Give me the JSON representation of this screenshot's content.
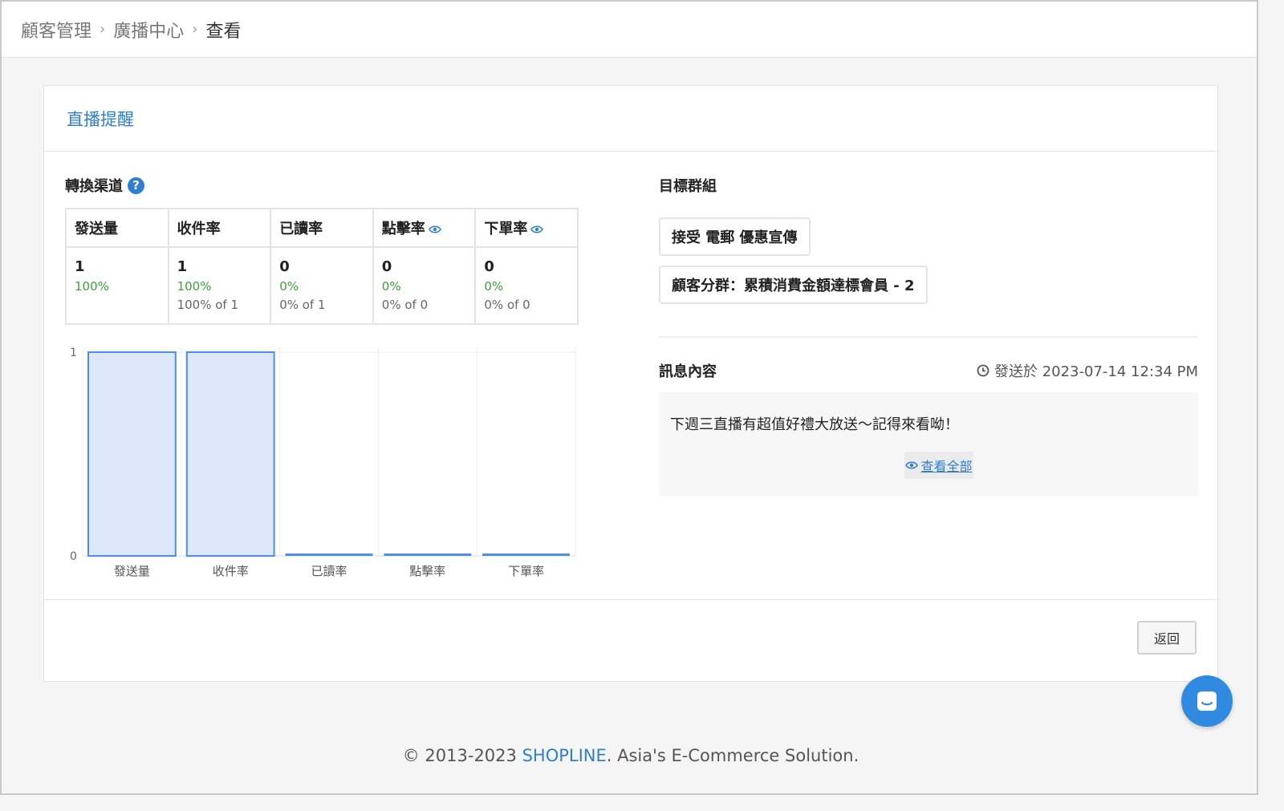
{
  "breadcrumb": {
    "items": [
      "顧客管理",
      "廣播中心"
    ],
    "current": "查看",
    "separator": "›"
  },
  "card": {
    "title": "直播提醒"
  },
  "conversion": {
    "title": "轉換渠道",
    "columns": [
      {
        "label": "發送量",
        "has_eye": false
      },
      {
        "label": "收件率",
        "has_eye": false
      },
      {
        "label": "已讀率",
        "has_eye": false
      },
      {
        "label": "點擊率",
        "has_eye": true
      },
      {
        "label": "下單率",
        "has_eye": true
      }
    ],
    "cells": [
      {
        "count": "1",
        "pct": "100%",
        "of": ""
      },
      {
        "count": "1",
        "pct": "100%",
        "of": "100% of 1"
      },
      {
        "count": "0",
        "pct": "0%",
        "of": "0% of 1"
      },
      {
        "count": "0",
        "pct": "0%",
        "of": "0% of 0"
      },
      {
        "count": "0",
        "pct": "0%",
        "of": "0% of 0"
      }
    ]
  },
  "chart_data": {
    "type": "bar",
    "categories": [
      "發送量",
      "收件率",
      "已讀率",
      "點擊率",
      "下單率"
    ],
    "values": [
      1,
      1,
      0,
      0,
      0
    ],
    "ylim": [
      0,
      1
    ],
    "yticks": [
      "0",
      "1"
    ],
    "grid": true,
    "bar_fill": "#dce8f9",
    "bar_stroke": "#4a8ee8"
  },
  "target": {
    "title": "目標群組",
    "tags": [
      "接受 電郵 優惠宣傳",
      "顧客分群：累積消費金額達標會員 - 2"
    ]
  },
  "message": {
    "title": "訊息內容",
    "sent_at": "發送於 2023-07-14 12:34 PM",
    "content": "下週三直播有超值好禮大放送～記得來看呦！",
    "view_all": "查看全部"
  },
  "actions": {
    "back": "返回"
  },
  "footer": {
    "prefix": "© 2013-2023 ",
    "brand": "SHOPLINE",
    "suffix": ". Asia's E-Commerce Solution."
  },
  "colors": {
    "accent": "#2f7fd0",
    "success": "#3aa33a"
  }
}
